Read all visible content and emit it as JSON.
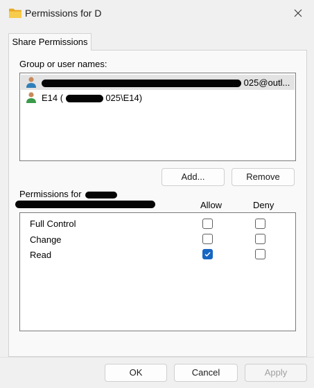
{
  "window": {
    "title": "Permissions for D"
  },
  "tabs": [
    {
      "label": "Share Permissions",
      "active": true
    }
  ],
  "users_section": {
    "label": "Group or user names:",
    "users": [
      {
        "prefix": "",
        "suffix": "025@outl...",
        "selected": true
      },
      {
        "prefix": "E14 (",
        "suffix": "025\\E14)",
        "selected": false
      }
    ],
    "add_label": "Add...",
    "remove_label": "Remove"
  },
  "permissions_section": {
    "label": "Permissions for",
    "allow_header": "Allow",
    "deny_header": "Deny",
    "rows": [
      {
        "name": "Full Control",
        "allow": false,
        "deny": false
      },
      {
        "name": "Change",
        "allow": false,
        "deny": false
      },
      {
        "name": "Read",
        "allow": true,
        "deny": false
      }
    ]
  },
  "footer": {
    "ok_label": "OK",
    "cancel_label": "Cancel",
    "apply_label": "Apply",
    "apply_enabled": false
  },
  "colors": {
    "checkbox_checked": "#1766c2",
    "selection": "#e3e3e3",
    "folder": "#f3c23a"
  }
}
